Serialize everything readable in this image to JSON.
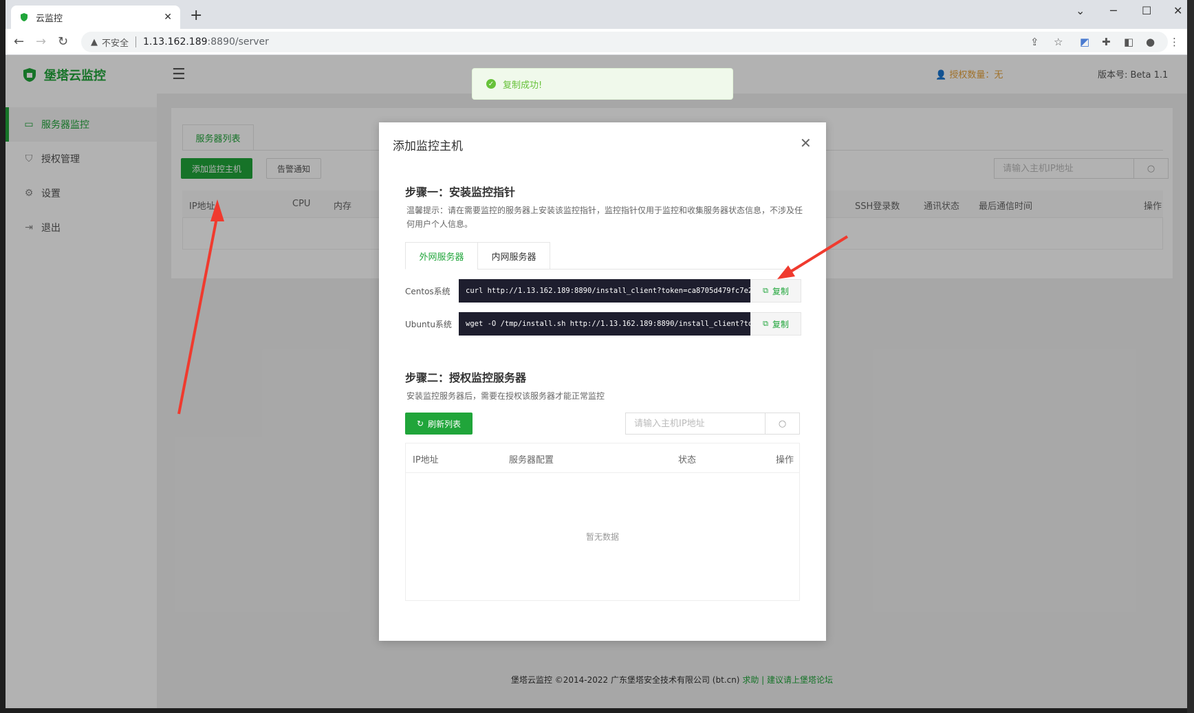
{
  "browser": {
    "tab_title": "云监控",
    "address_insecure": "不安全",
    "address_host": "1.13.162.189",
    "address_path": ":8890/server"
  },
  "app": {
    "brand": "堡塔云监控",
    "accent_color": "#20a53a",
    "header": {
      "auth_count": "授权数量：无",
      "version": "版本号: Beta 1.1"
    },
    "sidebar": {
      "items": [
        {
          "label": "服务器监控",
          "icon": "monitor-icon"
        },
        {
          "label": "授权管理",
          "icon": "shield-icon"
        },
        {
          "label": "设置",
          "icon": "gear-icon"
        },
        {
          "label": "退出",
          "icon": "logout-icon"
        }
      ]
    },
    "content": {
      "tab": "服务器列表",
      "add_button": "添加监控主机",
      "alert_button": "告警通知",
      "search_placeholder": "请输入主机IP地址",
      "columns": [
        "IP地址",
        "CPU",
        "内存",
        "SSH登录数",
        "通讯状态",
        "最后通信时间",
        "操作"
      ]
    },
    "footer": {
      "copyright": "堡塔云监控 ©2014-2022 广东堡塔安全技术有限公司 (bt.cn)",
      "help": "求助",
      "sep": "|",
      "forum": "建议请上堡塔论坛"
    }
  },
  "toast": {
    "message": "复制成功!"
  },
  "modal": {
    "title": "添加监控主机",
    "step1_title": "步骤一：安装监控指针",
    "step1_tip": "温馨提示：请在需要监控的服务器上安装该监控指针，监控指针仅用于监控和收集服务器状态信息，不涉及任何用户个人信息。",
    "tabs": [
      "外网服务器",
      "内网服务器"
    ],
    "rows": [
      {
        "os": "Centos系统",
        "command": "curl http://1.13.162.189:8890/install_client?token=ca8705d479fc7e2 |",
        "copy": "复制"
      },
      {
        "os": "Ubuntu系统",
        "command": "wget -O /tmp/install.sh http://1.13.162.189:8890/install_client?token",
        "copy": "复制"
      }
    ],
    "step2_title": "步骤二：授权监控服务器",
    "step2_tip": "安装监控服务器后，需要在授权该服务器才能正常监控",
    "refresh_button": "刷新列表",
    "search_placeholder": "请输入主机IP地址",
    "columns": [
      "IP地址",
      "服务器配置",
      "状态",
      "操作"
    ],
    "empty_text": "暂无数据"
  }
}
